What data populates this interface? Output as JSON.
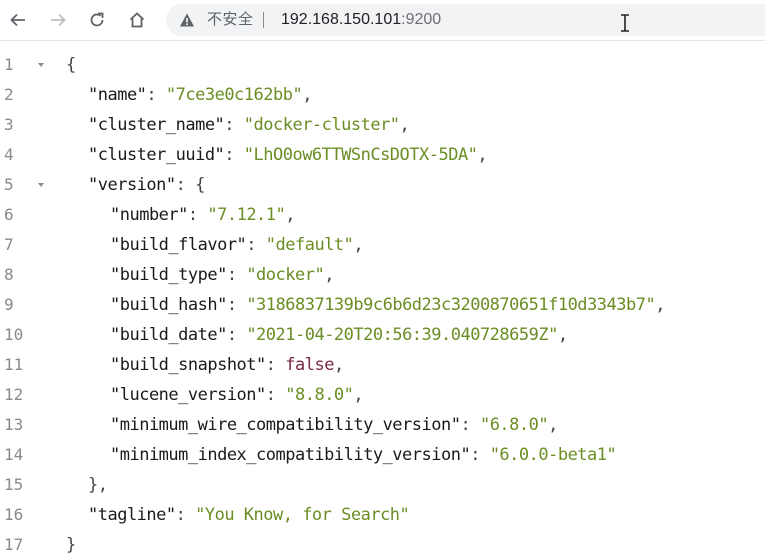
{
  "browser": {
    "security_label": "不安全",
    "url_host": "192.168.150.101",
    "url_port": ":9200"
  },
  "json_lines": [
    {
      "n": "1",
      "fold": true,
      "segments": [
        {
          "t": "{",
          "c": "p"
        }
      ]
    },
    {
      "n": "2",
      "indent": 1,
      "segments": [
        {
          "t": "\"name\"",
          "c": "k"
        },
        {
          "t": ": ",
          "c": "p"
        },
        {
          "t": "\"7ce3e0c162bb\"",
          "c": "s"
        },
        {
          "t": ",",
          "c": "p"
        }
      ]
    },
    {
      "n": "3",
      "indent": 1,
      "segments": [
        {
          "t": "\"cluster_name\"",
          "c": "k"
        },
        {
          "t": ": ",
          "c": "p"
        },
        {
          "t": "\"docker-cluster\"",
          "c": "s"
        },
        {
          "t": ",",
          "c": "p"
        }
      ]
    },
    {
      "n": "4",
      "indent": 1,
      "segments": [
        {
          "t": "\"cluster_uuid\"",
          "c": "k"
        },
        {
          "t": ": ",
          "c": "p"
        },
        {
          "t": "\"LhO0ow6TTWSnCsDOTX-5DA\"",
          "c": "s"
        },
        {
          "t": ",",
          "c": "p"
        }
      ]
    },
    {
      "n": "5",
      "indent": 1,
      "fold": true,
      "segments": [
        {
          "t": "\"version\"",
          "c": "k"
        },
        {
          "t": ": {",
          "c": "p"
        }
      ]
    },
    {
      "n": "6",
      "indent": 2,
      "segments": [
        {
          "t": "\"number\"",
          "c": "k"
        },
        {
          "t": ": ",
          "c": "p"
        },
        {
          "t": "\"7.12.1\"",
          "c": "s"
        },
        {
          "t": ",",
          "c": "p"
        }
      ]
    },
    {
      "n": "7",
      "indent": 2,
      "segments": [
        {
          "t": "\"build_flavor\"",
          "c": "k"
        },
        {
          "t": ": ",
          "c": "p"
        },
        {
          "t": "\"default\"",
          "c": "s"
        },
        {
          "t": ",",
          "c": "p"
        }
      ]
    },
    {
      "n": "8",
      "indent": 2,
      "segments": [
        {
          "t": "\"build_type\"",
          "c": "k"
        },
        {
          "t": ": ",
          "c": "p"
        },
        {
          "t": "\"docker\"",
          "c": "s"
        },
        {
          "t": ",",
          "c": "p"
        }
      ]
    },
    {
      "n": "9",
      "indent": 2,
      "segments": [
        {
          "t": "\"build_hash\"",
          "c": "k"
        },
        {
          "t": ": ",
          "c": "p"
        },
        {
          "t": "\"3186837139b9c6b6d23c3200870651f10d3343b7\"",
          "c": "s"
        },
        {
          "t": ",",
          "c": "p"
        }
      ]
    },
    {
      "n": "10",
      "indent": 2,
      "segments": [
        {
          "t": "\"build_date\"",
          "c": "k"
        },
        {
          "t": ": ",
          "c": "p"
        },
        {
          "t": "\"2021-04-20T20:56:39.040728659Z\"",
          "c": "s"
        },
        {
          "t": ",",
          "c": "p"
        }
      ]
    },
    {
      "n": "11",
      "indent": 2,
      "segments": [
        {
          "t": "\"build_snapshot\"",
          "c": "k"
        },
        {
          "t": ": ",
          "c": "p"
        },
        {
          "t": "false",
          "c": "b"
        },
        {
          "t": ",",
          "c": "p"
        }
      ]
    },
    {
      "n": "12",
      "indent": 2,
      "segments": [
        {
          "t": "\"lucene_version\"",
          "c": "k"
        },
        {
          "t": ": ",
          "c": "p"
        },
        {
          "t": "\"8.8.0\"",
          "c": "s"
        },
        {
          "t": ",",
          "c": "p"
        }
      ]
    },
    {
      "n": "13",
      "indent": 2,
      "segments": [
        {
          "t": "\"minimum_wire_compatibility_version\"",
          "c": "k"
        },
        {
          "t": ": ",
          "c": "p"
        },
        {
          "t": "\"6.8.0\"",
          "c": "s"
        },
        {
          "t": ",",
          "c": "p"
        }
      ]
    },
    {
      "n": "14",
      "indent": 2,
      "segments": [
        {
          "t": "\"minimum_index_compatibility_version\"",
          "c": "k"
        },
        {
          "t": ": ",
          "c": "p"
        },
        {
          "t": "\"6.0.0-beta1\"",
          "c": "s"
        }
      ]
    },
    {
      "n": "15",
      "indent": 1,
      "segments": [
        {
          "t": "},",
          "c": "p"
        }
      ]
    },
    {
      "n": "16",
      "indent": 1,
      "segments": [
        {
          "t": "\"tagline\"",
          "c": "k"
        },
        {
          "t": ": ",
          "c": "p"
        },
        {
          "t": "\"You Know, for Search\"",
          "c": "s"
        }
      ]
    },
    {
      "n": "17",
      "segments": [
        {
          "t": "}",
          "c": "p"
        }
      ]
    }
  ],
  "colors": {
    "string": "#6a8e23",
    "boolean": "#7a2946",
    "key": "#1a1a1a",
    "line_number": "#8a8a8a"
  }
}
